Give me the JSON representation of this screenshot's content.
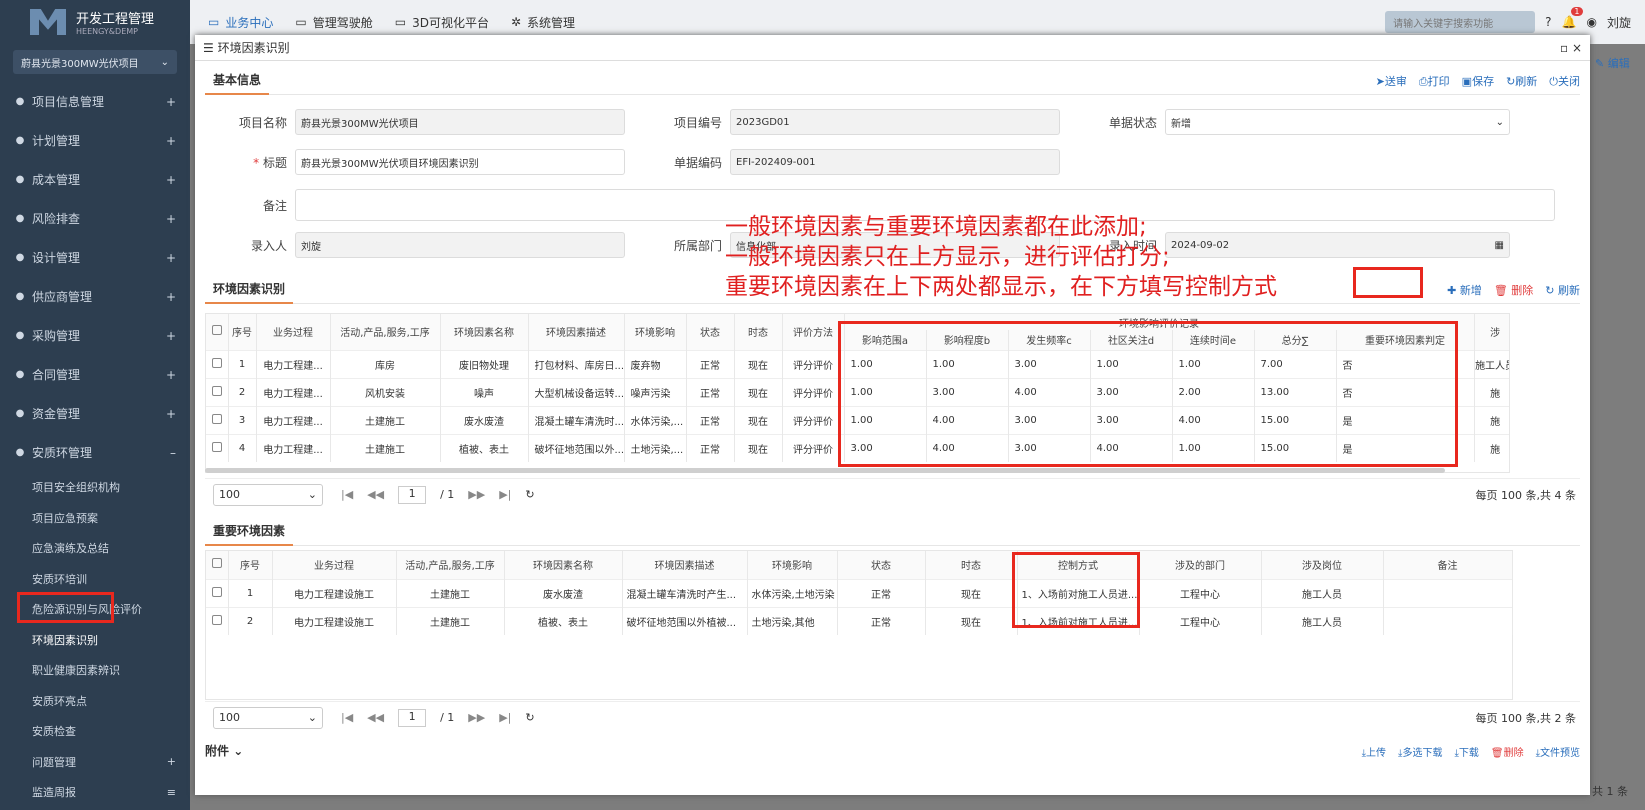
{
  "app": {
    "title": "开发工程管理",
    "subtitle": "HEENGY&DEMP",
    "project": "蔚县光景300MW光伏项目"
  },
  "nav": [
    {
      "label": "项目信息管理",
      "icon": "info-icon",
      "sign": "+"
    },
    {
      "label": "计划管理",
      "icon": "calendar-icon",
      "sign": "+"
    },
    {
      "label": "成本管理",
      "icon": "coin-icon",
      "sign": "+"
    },
    {
      "label": "风险排查",
      "icon": "calendar-check-icon",
      "sign": "+"
    },
    {
      "label": "设计管理",
      "icon": "eye-icon",
      "sign": "+"
    },
    {
      "label": "供应商管理",
      "icon": "user-icon",
      "sign": "+"
    },
    {
      "label": "采购管理",
      "icon": "scale-icon",
      "sign": "+"
    },
    {
      "label": "合同管理",
      "icon": "card-icon",
      "sign": "+"
    },
    {
      "label": "资金管理",
      "icon": "coins-icon",
      "sign": "+"
    },
    {
      "label": "安质环管理",
      "icon": "shield-icon",
      "sign": "–"
    }
  ],
  "subnav": [
    "项目安全组织机构",
    "项目应急预案",
    "应急演练及总结",
    "安质环培训",
    "危险源识别与风险评价",
    "环境因素识别",
    "职业健康因素辨识",
    "安质环亮点",
    "安质检查",
    "问题管理",
    "监造周报"
  ],
  "topbar": {
    "tabs": [
      "业务中心",
      "管理驾驶舱",
      "3D可视化平台",
      "系统管理"
    ],
    "search_placeholder": "请输入关键字搜索功能",
    "badge": "1",
    "user": "刘旋",
    "edit": "编辑",
    "behind_total": "共 1 条"
  },
  "modal": {
    "title": "环境因素识别"
  },
  "basic": {
    "title": "基本信息",
    "actions": [
      "送审",
      "打印",
      "保存",
      "刷新",
      "关闭"
    ],
    "fields": {
      "project_name_label": "项目名称",
      "project_name": "蔚县光景300MW光伏项目",
      "project_no_label": "项目编号",
      "project_no": "2023GD01",
      "status_label": "单据状态",
      "status": "新增",
      "title_label": "标题",
      "title": "蔚县光景300MW光伏项目环境因素识别",
      "code_label": "单据编码",
      "code": "EFI-202409-001",
      "remark_label": "备注",
      "remark": "",
      "entry_label": "录入人",
      "entry": "刘旋",
      "dept_label": "所属部门",
      "dept": "信息化部",
      "time_label": "录入时间",
      "time": "2024-09-02"
    }
  },
  "env": {
    "title": "环境因素识别",
    "add": "新增",
    "del": "删除",
    "refresh": "刷新",
    "group_header": "环境影响评价记录",
    "columns": [
      "序号",
      "业务过程",
      "活动,产品,服务,工序",
      "环境因素名称",
      "环境因素描述",
      "环境影响",
      "状态",
      "时态",
      "评价方法",
      "影响范围a",
      "影响程度b",
      "发生频率c",
      "社区关注d",
      "连续时间e",
      "总分∑",
      "重要环境因素判定",
      "涉"
    ],
    "rows": [
      [
        "1",
        "电力工程建...",
        "库房",
        "废旧物处理",
        "打包材料、库房日...",
        "废弃物",
        "正常",
        "现在",
        "评分评价",
        "1.00",
        "1.00",
        "3.00",
        "1.00",
        "1.00",
        "7.00",
        "否",
        "施工人员"
      ],
      [
        "2",
        "电力工程建...",
        "风机安装",
        "噪声",
        "大型机械设备运转...",
        "噪声污染",
        "正常",
        "现在",
        "评分评价",
        "1.00",
        "3.00",
        "4.00",
        "3.00",
        "2.00",
        "13.00",
        "否",
        "施"
      ],
      [
        "3",
        "电力工程建...",
        "土建施工",
        "废水废渣",
        "混凝土罐车清洗时...",
        "水体污染,...",
        "正常",
        "现在",
        "评分评价",
        "1.00",
        "4.00",
        "3.00",
        "3.00",
        "4.00",
        "15.00",
        "是",
        "施"
      ],
      [
        "4",
        "电力工程建...",
        "土建施工",
        "植被、表土",
        "破坏征地范围以外...",
        "土地污染,...",
        "正常",
        "现在",
        "评分评价",
        "3.00",
        "4.00",
        "3.00",
        "4.00",
        "1.00",
        "15.00",
        "是",
        "施"
      ]
    ],
    "pager": {
      "size": "100",
      "page": "1",
      "total_pages": "/ 1",
      "summary": "每页 100 条,共 4 条"
    }
  },
  "important": {
    "title": "重要环境因素",
    "columns": [
      "序号",
      "业务过程",
      "活动,产品,服务,工序",
      "环境因素名称",
      "环境因素描述",
      "环境影响",
      "状态",
      "时态",
      "控制方式",
      "涉及的部门",
      "涉及岗位",
      "备注"
    ],
    "rows": [
      [
        "1",
        "电力工程建设施工",
        "土建施工",
        "废水废渣",
        "混凝土罐车清洗时产生...",
        "水体污染,土地污染",
        "正常",
        "现在",
        "1、入场前对施工人员进...",
        "工程中心",
        "施工人员",
        ""
      ],
      [
        "2",
        "电力工程建设施工",
        "土建施工",
        "植被、表土",
        "破坏征地范围以外植被...",
        "土地污染,其他",
        "正常",
        "现在",
        "1、入场前对施工人员进...",
        "工程中心",
        "施工人员",
        ""
      ]
    ],
    "pager": {
      "size": "100",
      "page": "1",
      "total_pages": "/ 1",
      "summary": "每页 100 条,共 2 条"
    }
  },
  "attach": {
    "title": "附件",
    "actions": [
      "上传",
      "多选下载",
      "下载",
      "删除",
      "文件预览"
    ]
  },
  "annotation": [
    "一般环境因素与重要环境因素都在此添加;",
    "一般环境因素只在上方显示，进行评估打分;",
    "重要环境因素在上下两处都显示，在下方填写控制方式"
  ]
}
